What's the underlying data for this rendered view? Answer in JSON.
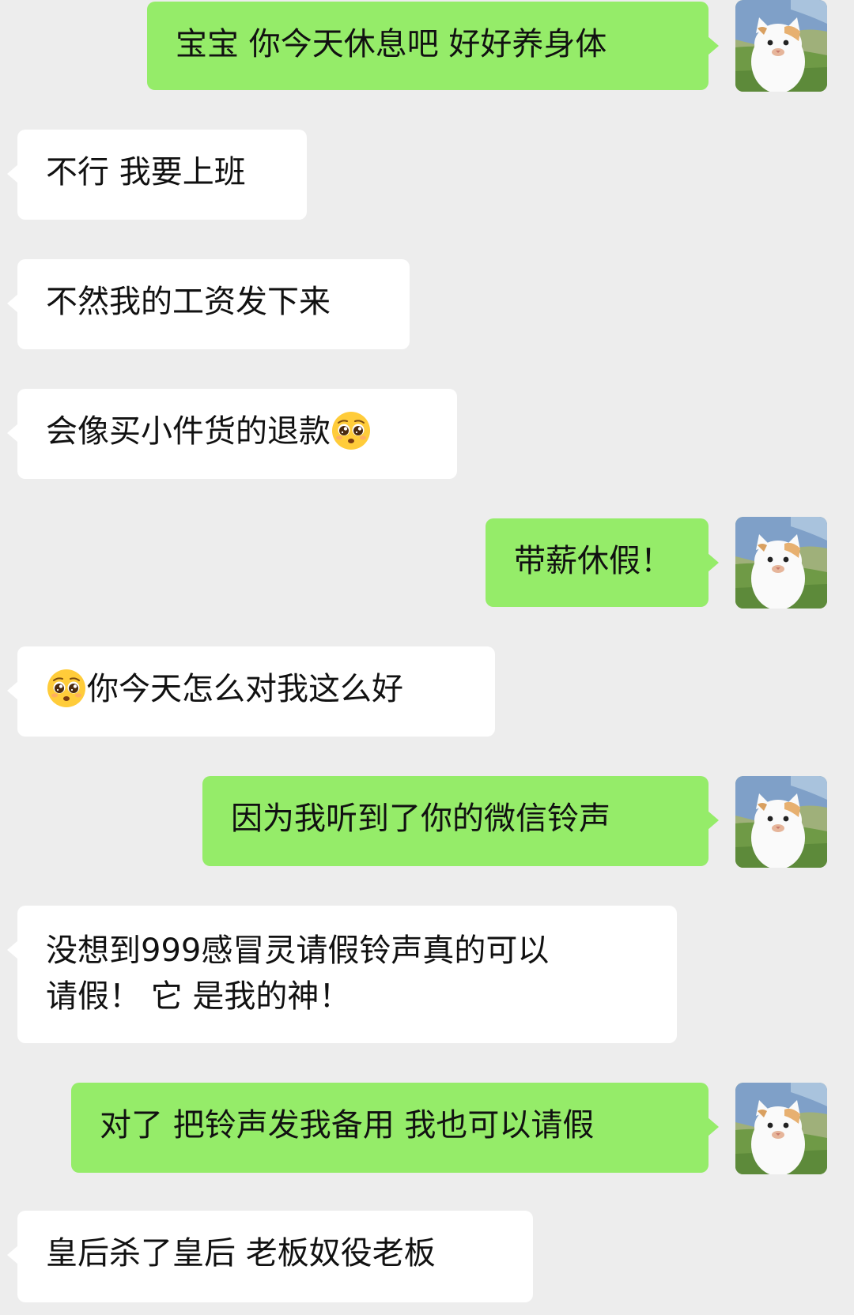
{
  "chat": {
    "messages": [
      {
        "from": "me",
        "text": "宝宝 你今天休息吧 好好养身体"
      },
      {
        "from": "other",
        "text": "不行 我要上班"
      },
      {
        "from": "other",
        "text": "不然我的工资发下来"
      },
      {
        "from": "other",
        "text": "会像买小件货的退款",
        "emoji": "pleading-face-emoji"
      },
      {
        "from": "me",
        "text": "带薪休假！"
      },
      {
        "from": "other",
        "text": "你今天怎么对我这么好",
        "emoji": "pleading-face-emoji"
      },
      {
        "from": "me",
        "text": "因为我听到了你的微信铃声"
      },
      {
        "from": "other",
        "lines": [
          "没想到999感冒灵请假铃声真的可以",
          "请假！ 它 是我的神！"
        ]
      },
      {
        "from": "me",
        "text": "对了 把铃声发我备用 我也可以请假"
      },
      {
        "from": "other",
        "text": "皇后杀了皇后 老板奴役老板"
      }
    ]
  },
  "colors": {
    "background": "#ededed",
    "outgoing_bubble": "#95ec69",
    "incoming_bubble": "#ffffff",
    "text": "#111111"
  },
  "icons": {
    "my_avatar": "cat-avatar",
    "emoji": "pleading-face-emoji"
  }
}
